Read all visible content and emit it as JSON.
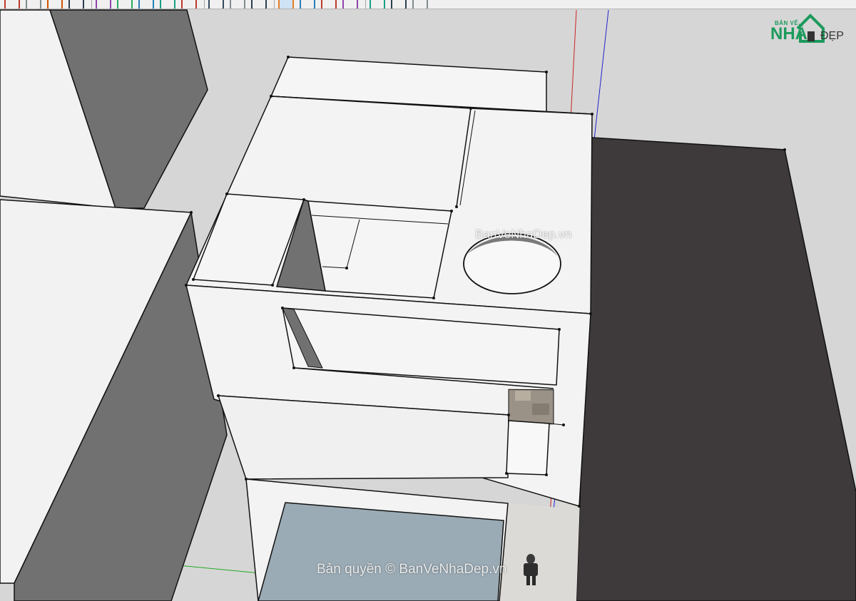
{
  "app": {
    "toolbar_icons": [
      "pencil-icon",
      "eraser-icon",
      "paint-bucket-icon",
      "line-icon",
      "arc-icon",
      "rectangle-icon",
      "push-pull-icon",
      "move-icon",
      "rotate-icon",
      "offset-icon",
      "tape-measure-icon",
      "text-icon",
      "orbit-icon",
      "pan-icon",
      "zoom-icon",
      "zoom-extents-icon",
      "walk-icon",
      "look-around-icon",
      "section-plane-icon"
    ]
  },
  "logo": {
    "top_text": "BẢN VẼ",
    "main_text": "NHÀ",
    "suffix_text": "ĐẸP"
  },
  "watermarks": {
    "top": "BanVeNhaDep.vn",
    "bottom": "Bản quyền © BanVeNhaDep.vn"
  },
  "colors": {
    "sky": "#d6d6d6",
    "building_white": "#f3f3f3",
    "building_gray": "#717171",
    "road": "#3e3a3b",
    "glass": "#9babb5",
    "axis_red": "#cc2222",
    "axis_blue": "#2222cc",
    "axis_green": "#22aa22",
    "brand_green": "#1c9a5c"
  }
}
